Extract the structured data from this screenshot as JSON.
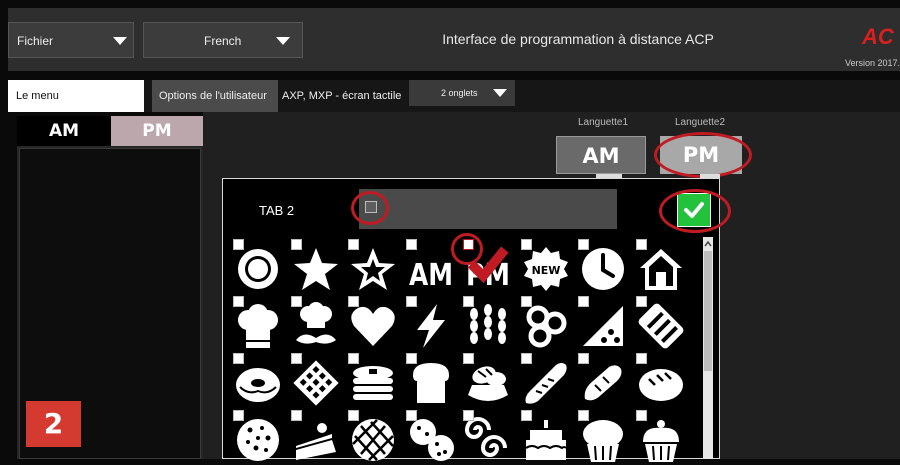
{
  "titlebar": {
    "file_menu": "Fichier",
    "language": "French",
    "title": "Interface de programmation à distance ACP",
    "version": "Version 2017.",
    "logo_text": "AC"
  },
  "tabrow": {
    "menu_label": "Le menu",
    "user_options": "Options de l'utilisateur",
    "screen_type": "AXP, MXP - écran tactile",
    "tabs_select": "2 onglets"
  },
  "left_panel": {
    "tab_am": "AM",
    "tab_pm": "PM"
  },
  "language_tabs": {
    "label1": "Languette1",
    "label2": "Languette2",
    "btn1": "AM",
    "btn2": "PM"
  },
  "dialog": {
    "tab_label": "TAB 2",
    "name_value": "",
    "icons": [
      {
        "name": "circle",
        "checked": false
      },
      {
        "name": "star",
        "checked": false
      },
      {
        "name": "star-outline",
        "checked": false
      },
      {
        "name": "am",
        "checked": false,
        "text": "AM"
      },
      {
        "name": "pm",
        "checked": true,
        "text": "PM"
      },
      {
        "name": "new-badge",
        "checked": false,
        "text": "NEW"
      },
      {
        "name": "clock",
        "checked": false
      },
      {
        "name": "home",
        "checked": false
      },
      {
        "name": "chef-hat",
        "checked": false
      },
      {
        "name": "chef-mustache",
        "checked": false
      },
      {
        "name": "heart",
        "checked": false
      },
      {
        "name": "lightning",
        "checked": false
      },
      {
        "name": "wheat",
        "checked": false
      },
      {
        "name": "bagels",
        "checked": false
      },
      {
        "name": "pizza-slice",
        "checked": false
      },
      {
        "name": "candy-bar",
        "checked": false
      },
      {
        "name": "donut",
        "checked": false
      },
      {
        "name": "waffle",
        "checked": false
      },
      {
        "name": "pancakes",
        "checked": false
      },
      {
        "name": "bread-slice",
        "checked": false
      },
      {
        "name": "bread-basket",
        "checked": false
      },
      {
        "name": "baguette",
        "checked": false
      },
      {
        "name": "croissant",
        "checked": false
      },
      {
        "name": "bread-loaf",
        "checked": false
      },
      {
        "name": "cookie",
        "checked": false
      },
      {
        "name": "cake-slice",
        "checked": false
      },
      {
        "name": "pie",
        "checked": false
      },
      {
        "name": "cookies",
        "checked": false
      },
      {
        "name": "cinnamon-rolls",
        "checked": false
      },
      {
        "name": "cake",
        "checked": false
      },
      {
        "name": "muffin",
        "checked": false
      },
      {
        "name": "cupcake",
        "checked": false
      }
    ]
  },
  "badge": {
    "number": "2"
  },
  "colors": {
    "highlight_ring": "#c01b22",
    "ok_green": "#22c23d",
    "badge_red": "#d43a2f"
  }
}
